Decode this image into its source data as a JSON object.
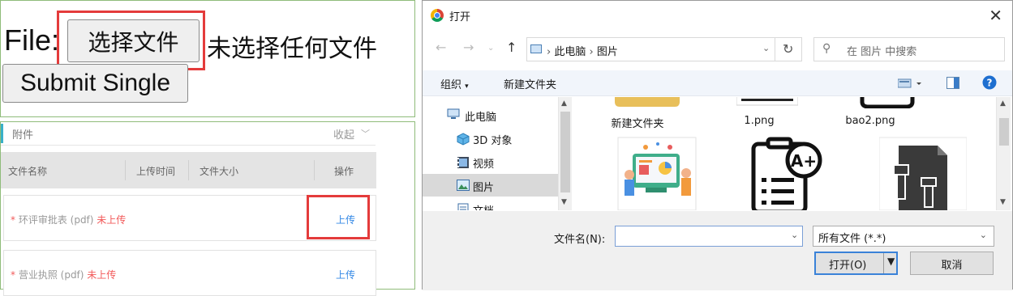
{
  "form": {
    "file_label": "File:",
    "choose_button": "选择文件",
    "no_file_text": "未选择任何文件",
    "submit_button": "Submit Single"
  },
  "attachments": {
    "title": "附件",
    "collapse": "收起",
    "columns": [
      "文件名称",
      "上传时间",
      "文件大小",
      "操作"
    ],
    "rows": [
      {
        "required_mark": "*",
        "name": "环评审批表 (pdf)",
        "status": "未上传",
        "action": "上传"
      },
      {
        "required_mark": "*",
        "name": "营业执照 (pdf)",
        "status": "未上传",
        "action": "上传"
      }
    ]
  },
  "dialog": {
    "title": "打开",
    "breadcrumb": [
      "此电脑",
      "图片"
    ],
    "search_placeholder": "在 图片 中搜索",
    "toolbar": {
      "organize": "组织",
      "new_folder": "新建文件夹"
    },
    "nav_items": [
      "此电脑",
      "3D 对象",
      "视频",
      "图片",
      "文档"
    ],
    "selected_nav": "图片",
    "files_row1": [
      "新建文件夹",
      "1.png",
      "bao2.png"
    ],
    "filename_label": "文件名(N):",
    "filename_value": "",
    "filetype": "所有文件 (*.*)",
    "open_button": "打开(O)",
    "cancel_button": "取消"
  },
  "colors": {
    "highlight": "#e43b3b",
    "link": "#3388e6",
    "required": "#f25a5a"
  }
}
